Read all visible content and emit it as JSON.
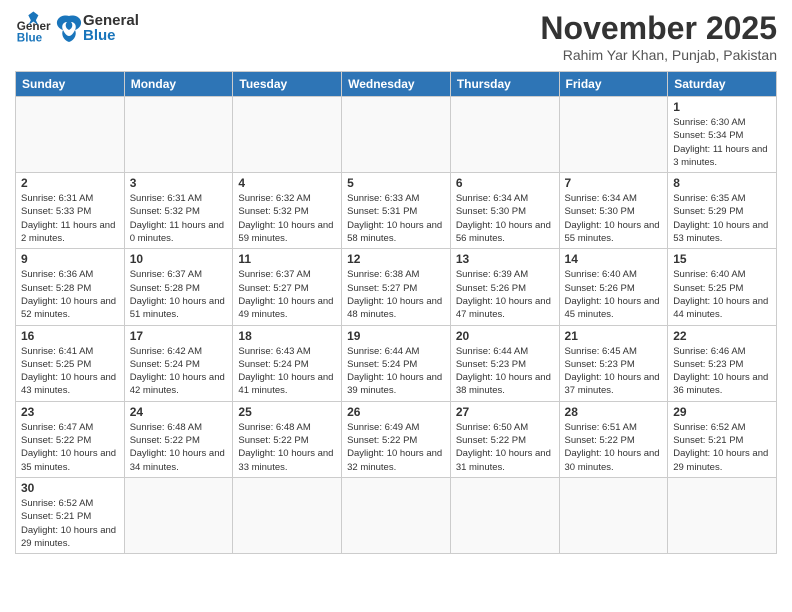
{
  "header": {
    "logo_general": "General",
    "logo_blue": "Blue",
    "month": "November 2025",
    "location": "Rahim Yar Khan, Punjab, Pakistan"
  },
  "weekdays": [
    "Sunday",
    "Monday",
    "Tuesday",
    "Wednesday",
    "Thursday",
    "Friday",
    "Saturday"
  ],
  "weeks": [
    [
      {
        "day": "",
        "info": ""
      },
      {
        "day": "",
        "info": ""
      },
      {
        "day": "",
        "info": ""
      },
      {
        "day": "",
        "info": ""
      },
      {
        "day": "",
        "info": ""
      },
      {
        "day": "",
        "info": ""
      },
      {
        "day": "1",
        "info": "Sunrise: 6:30 AM\nSunset: 5:34 PM\nDaylight: 11 hours and 3 minutes."
      }
    ],
    [
      {
        "day": "2",
        "info": "Sunrise: 6:31 AM\nSunset: 5:33 PM\nDaylight: 11 hours and 2 minutes."
      },
      {
        "day": "3",
        "info": "Sunrise: 6:31 AM\nSunset: 5:32 PM\nDaylight: 11 hours and 0 minutes."
      },
      {
        "day": "4",
        "info": "Sunrise: 6:32 AM\nSunset: 5:32 PM\nDaylight: 10 hours and 59 minutes."
      },
      {
        "day": "5",
        "info": "Sunrise: 6:33 AM\nSunset: 5:31 PM\nDaylight: 10 hours and 58 minutes."
      },
      {
        "day": "6",
        "info": "Sunrise: 6:34 AM\nSunset: 5:30 PM\nDaylight: 10 hours and 56 minutes."
      },
      {
        "day": "7",
        "info": "Sunrise: 6:34 AM\nSunset: 5:30 PM\nDaylight: 10 hours and 55 minutes."
      },
      {
        "day": "8",
        "info": "Sunrise: 6:35 AM\nSunset: 5:29 PM\nDaylight: 10 hours and 53 minutes."
      }
    ],
    [
      {
        "day": "9",
        "info": "Sunrise: 6:36 AM\nSunset: 5:28 PM\nDaylight: 10 hours and 52 minutes."
      },
      {
        "day": "10",
        "info": "Sunrise: 6:37 AM\nSunset: 5:28 PM\nDaylight: 10 hours and 51 minutes."
      },
      {
        "day": "11",
        "info": "Sunrise: 6:37 AM\nSunset: 5:27 PM\nDaylight: 10 hours and 49 minutes."
      },
      {
        "day": "12",
        "info": "Sunrise: 6:38 AM\nSunset: 5:27 PM\nDaylight: 10 hours and 48 minutes."
      },
      {
        "day": "13",
        "info": "Sunrise: 6:39 AM\nSunset: 5:26 PM\nDaylight: 10 hours and 47 minutes."
      },
      {
        "day": "14",
        "info": "Sunrise: 6:40 AM\nSunset: 5:26 PM\nDaylight: 10 hours and 45 minutes."
      },
      {
        "day": "15",
        "info": "Sunrise: 6:40 AM\nSunset: 5:25 PM\nDaylight: 10 hours and 44 minutes."
      }
    ],
    [
      {
        "day": "16",
        "info": "Sunrise: 6:41 AM\nSunset: 5:25 PM\nDaylight: 10 hours and 43 minutes."
      },
      {
        "day": "17",
        "info": "Sunrise: 6:42 AM\nSunset: 5:24 PM\nDaylight: 10 hours and 42 minutes."
      },
      {
        "day": "18",
        "info": "Sunrise: 6:43 AM\nSunset: 5:24 PM\nDaylight: 10 hours and 41 minutes."
      },
      {
        "day": "19",
        "info": "Sunrise: 6:44 AM\nSunset: 5:24 PM\nDaylight: 10 hours and 39 minutes."
      },
      {
        "day": "20",
        "info": "Sunrise: 6:44 AM\nSunset: 5:23 PM\nDaylight: 10 hours and 38 minutes."
      },
      {
        "day": "21",
        "info": "Sunrise: 6:45 AM\nSunset: 5:23 PM\nDaylight: 10 hours and 37 minutes."
      },
      {
        "day": "22",
        "info": "Sunrise: 6:46 AM\nSunset: 5:23 PM\nDaylight: 10 hours and 36 minutes."
      }
    ],
    [
      {
        "day": "23",
        "info": "Sunrise: 6:47 AM\nSunset: 5:22 PM\nDaylight: 10 hours and 35 minutes."
      },
      {
        "day": "24",
        "info": "Sunrise: 6:48 AM\nSunset: 5:22 PM\nDaylight: 10 hours and 34 minutes."
      },
      {
        "day": "25",
        "info": "Sunrise: 6:48 AM\nSunset: 5:22 PM\nDaylight: 10 hours and 33 minutes."
      },
      {
        "day": "26",
        "info": "Sunrise: 6:49 AM\nSunset: 5:22 PM\nDaylight: 10 hours and 32 minutes."
      },
      {
        "day": "27",
        "info": "Sunrise: 6:50 AM\nSunset: 5:22 PM\nDaylight: 10 hours and 31 minutes."
      },
      {
        "day": "28",
        "info": "Sunrise: 6:51 AM\nSunset: 5:22 PM\nDaylight: 10 hours and 30 minutes."
      },
      {
        "day": "29",
        "info": "Sunrise: 6:52 AM\nSunset: 5:21 PM\nDaylight: 10 hours and 29 minutes."
      }
    ],
    [
      {
        "day": "30",
        "info": "Sunrise: 6:52 AM\nSunset: 5:21 PM\nDaylight: 10 hours and 29 minutes."
      },
      {
        "day": "",
        "info": ""
      },
      {
        "day": "",
        "info": ""
      },
      {
        "day": "",
        "info": ""
      },
      {
        "day": "",
        "info": ""
      },
      {
        "day": "",
        "info": ""
      },
      {
        "day": "",
        "info": ""
      }
    ]
  ]
}
